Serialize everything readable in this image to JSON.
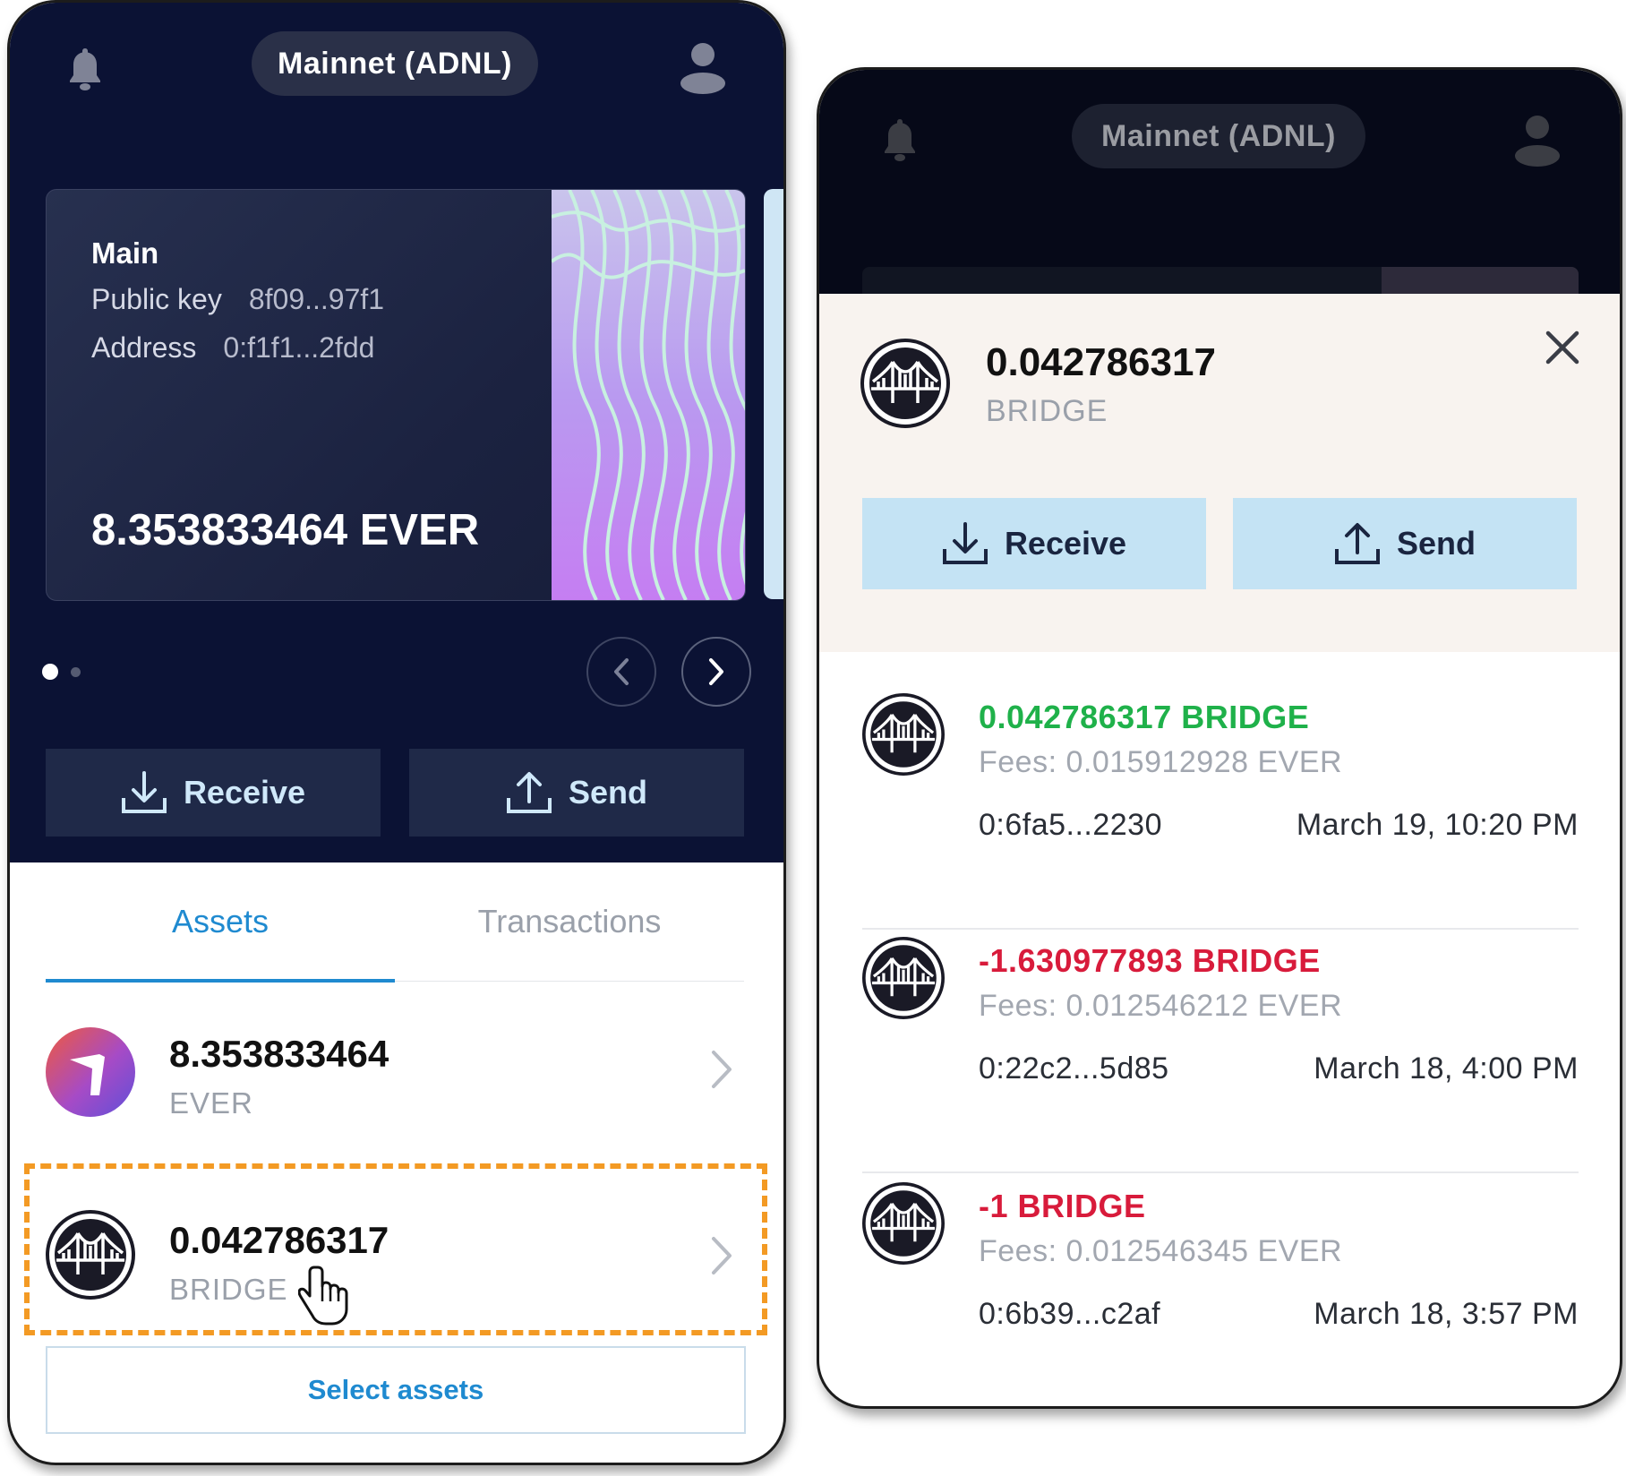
{
  "network": "Mainnet (ADNL)",
  "account": {
    "name": "Main",
    "public_key_label": "Public key",
    "public_key": "8f09...97f1",
    "address_label": "Address",
    "address": "0:f1f1...2fdd",
    "balance": "8.353833464 EVER"
  },
  "actions": {
    "receive": "Receive",
    "send": "Send"
  },
  "tabs": {
    "assets": "Assets",
    "transactions": "Transactions"
  },
  "assets": [
    {
      "amount": "8.353833464",
      "symbol": "EVER",
      "icon": "ever-logo-icon"
    },
    {
      "amount": "0.042786317",
      "symbol": "BRIDGE",
      "icon": "bridge-token-icon"
    }
  ],
  "select_assets": "Select assets",
  "asset_details": {
    "amount": "0.042786317",
    "symbol": "BRIDGE",
    "transactions": [
      {
        "amount": "0.042786317 BRIDGE",
        "direction": "in",
        "fees": "Fees: 0.015912928 EVER",
        "address": "0:6fa5...2230",
        "date": "March 19, 10:20 PM"
      },
      {
        "amount": "-1.630977893 BRIDGE",
        "direction": "out",
        "fees": "Fees: 0.012546212 EVER",
        "address": "0:22c2...5d85",
        "date": "March 18, 4:00 PM"
      },
      {
        "amount": "-1 BRIDGE",
        "direction": "out",
        "fees": "Fees: 0.012546345 EVER",
        "address": "0:6b39...c2af",
        "date": "March 18, 3:57 PM"
      }
    ]
  },
  "colors": {
    "header_bg": "#0b1234",
    "accent": "#1f8ad0",
    "positive": "#1fb14a",
    "negative": "#d81b3b",
    "highlight": "#f39a24",
    "action_light": "#c4e3f4"
  }
}
